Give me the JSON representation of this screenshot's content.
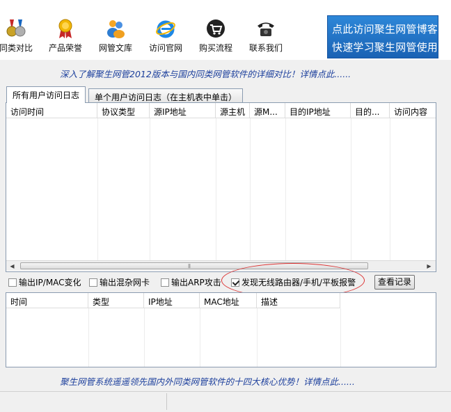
{
  "toolbar": {
    "items": [
      {
        "label": "同类对比",
        "icon": "medals-icon"
      },
      {
        "label": "产品荣誉",
        "icon": "award-ribbon-icon"
      },
      {
        "label": "网管文库",
        "icon": "people-icon"
      },
      {
        "label": "访问官网",
        "icon": "internet-explorer-icon"
      },
      {
        "label": "购买流程",
        "icon": "shopping-cart-icon"
      },
      {
        "label": "联系我们",
        "icon": "telephone-icon"
      }
    ],
    "banner": {
      "line1": "点此访问聚生网管博客",
      "line2": "快速学习聚生网管使用"
    }
  },
  "promo_top": "深入了解聚生网管2012版本与国内同类网管软件的详细对比！详情点此......",
  "tabs": [
    "所有用户访问日志",
    "单个用户访问日志（在主机表中单击）"
  ],
  "log_table": {
    "columns": [
      "访问时间",
      "协议类型",
      "源IP地址",
      "源主机",
      "源M...",
      "目的IP地址",
      "目的...",
      "访问内容"
    ]
  },
  "options": {
    "ip_mac_change": {
      "label": "输出IP/MAC变化",
      "checked": false
    },
    "promiscuous_nic": {
      "label": "输出混杂网卡",
      "checked": false
    },
    "arp_attack": {
      "label": "输出ARP攻击",
      "checked": false
    },
    "wireless_alert": {
      "label": "发现无线路由器/手机/平板报警",
      "checked": true
    },
    "view_records": "查看记录"
  },
  "alert_table": {
    "columns": [
      "时间",
      "类型",
      "IP地址",
      "MAC地址",
      "描述"
    ]
  },
  "promo_bottom": "聚生网管系统遥遥领先国内外同类网管软件的十四大核心优势！详情点此......",
  "colors": {
    "banner": "#1a62b4",
    "promo_text": "#1c3f9c",
    "highlight": "#d33333"
  }
}
